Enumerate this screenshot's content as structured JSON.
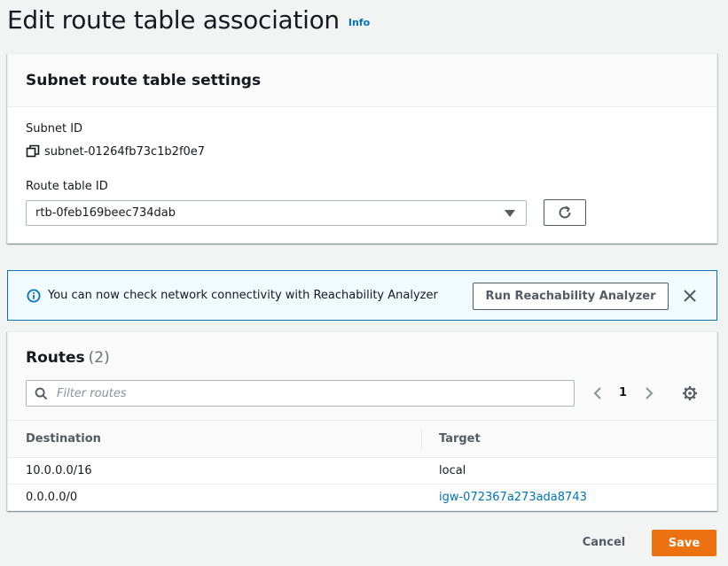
{
  "header": {
    "title": "Edit route table association",
    "info_label": "Info"
  },
  "settings": {
    "heading": "Subnet route table settings",
    "subnet_label": "Subnet ID",
    "subnet_value": "subnet-01264fb73c1b2f0e7",
    "route_table_label": "Route table ID",
    "route_table_value": "rtb-0feb169beec734dab"
  },
  "flash": {
    "message": "You can now check network connectivity with Reachability Analyzer",
    "button_label": "Run Reachability Analyzer"
  },
  "routes": {
    "title": "Routes",
    "count": "(2)",
    "filter_placeholder": "Filter routes",
    "page_number": "1",
    "columns": [
      "Destination",
      "Target"
    ],
    "rows": [
      {
        "destination": "10.0.0.0/16",
        "target": "local"
      },
      {
        "destination": "0.0.0.0/0",
        "target": "igw-072367a273ada8743"
      }
    ]
  },
  "footer": {
    "cancel_label": "Cancel",
    "save_label": "Save"
  },
  "colors": {
    "primary": "#ec7211",
    "link": "#0073bb",
    "info_border": "#0073bb",
    "info_bg": "#f1faff"
  },
  "icons": [
    "copy-icon",
    "caret-down-icon",
    "refresh-icon",
    "info-circle-icon",
    "close-icon",
    "search-icon",
    "chevron-left-icon",
    "chevron-right-icon",
    "gear-icon"
  ]
}
